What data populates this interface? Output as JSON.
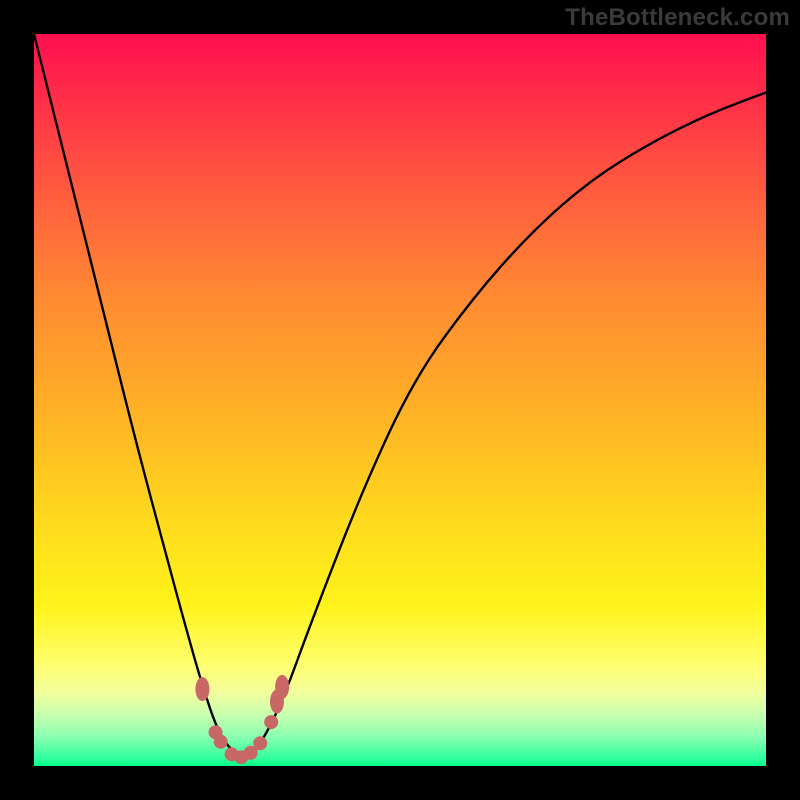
{
  "watermark": "TheBottleneck.com",
  "colors": {
    "frame_bg": "#000000",
    "watermark_text": "#3a3a3a",
    "curve_stroke": "#000000",
    "marker_fill": "#c96666",
    "gradient_stops": [
      "#ff0f4f",
      "#ff2b49",
      "#ff5d3e",
      "#ff8a32",
      "#ffb326",
      "#ffd91e",
      "#fff31a",
      "#fffe6d",
      "#f2ff9c",
      "#c8ffb0",
      "#8affb0",
      "#2fff9d",
      "#00ff88"
    ]
  },
  "chart_data": {
    "type": "line",
    "title": "",
    "xlabel": "",
    "ylabel": "",
    "note": "Minimum-seeking V-curve over a red→green gradient (bottleneck calculator style). Axes are unlabeled; x and y are normalized 0–100 reading from the plot frame.",
    "xlim": [
      0,
      100
    ],
    "ylim": [
      0,
      100
    ],
    "series": [
      {
        "name": "curve",
        "x": [
          0,
          5,
          10,
          14,
          18,
          21,
          23,
          25,
          27,
          29,
          31,
          34,
          38,
          45,
          52,
          60,
          68,
          76,
          84,
          92,
          100
        ],
        "y": [
          100,
          80,
          60,
          44,
          29,
          18,
          11,
          5,
          2,
          1,
          3,
          9,
          20,
          38,
          53,
          64,
          73,
          80,
          85,
          89,
          92
        ]
      }
    ],
    "markers": [
      {
        "x": 23.0,
        "y": 10.5
      },
      {
        "x": 24.8,
        "y": 4.6
      },
      {
        "x": 25.5,
        "y": 3.3
      },
      {
        "x": 27.0,
        "y": 1.6
      },
      {
        "x": 28.3,
        "y": 1.2
      },
      {
        "x": 29.6,
        "y": 1.8
      },
      {
        "x": 30.9,
        "y": 3.1
      },
      {
        "x": 32.4,
        "y": 6.0
      },
      {
        "x": 33.2,
        "y": 8.8
      },
      {
        "x": 33.9,
        "y": 10.8
      }
    ]
  }
}
